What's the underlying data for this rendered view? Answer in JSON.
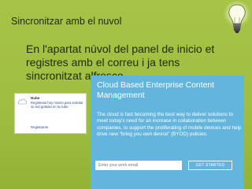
{
  "slide": {
    "title": "Sincronitzar amb el nuvol",
    "body": "En l'apartat núvol del panel de inicio et registres amb el correu i ja tens sincronitzat alfresco."
  },
  "small_screenshot": {
    "name": "Nube",
    "description": "Regístrese hoy mismo para solicitar su red gratuita en la nube.",
    "link": "Registrarse",
    "icon": "cloud-icon"
  },
  "cloud_panel": {
    "title": "Cloud Based Enterprise Content Management",
    "text": "The cloud is fast becoming the best way to deliver solutions to meet today's need for an increase in collaboration between companies, to support the proliferating of mobile devices and help drive new \"bring you own device\" (BYOD) policies.",
    "email_placeholder": "Enter your work email",
    "cta_label": "GET STARTED",
    "background_color": "#64b5de"
  },
  "colors": {
    "slide_background": "#9ebd3e",
    "text": "#1f2a0c"
  },
  "decoration": {
    "icon": "lightbulb-icon"
  }
}
